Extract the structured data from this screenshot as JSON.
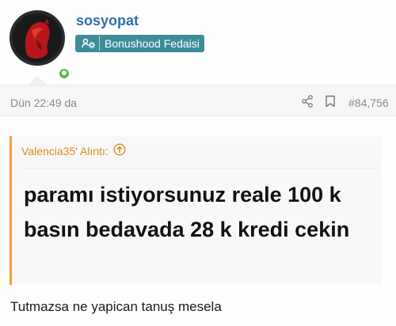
{
  "user": {
    "username": "sosyopat",
    "badge": "Bonushood Fedaisi"
  },
  "post": {
    "timestamp": "Dün 22:49 da",
    "number": "#84,756"
  },
  "quote": {
    "attribution": "Valencia35' Alıntı:",
    "text": "paramı istiyorsunuz reale 100 k basın bedavada 28 k kredi cekin"
  },
  "reply": {
    "text": "Tutmazsa ne yapican tanuş mesela"
  },
  "colors": {
    "username": "#2f6fae",
    "badge_bg": "#3d8d98",
    "online": "#61b34b",
    "quote_accent": "#f1a23a"
  },
  "icons": [
    "users-cog-icon",
    "share-icon",
    "bookmark-icon",
    "arrow-circle-up-icon"
  ]
}
